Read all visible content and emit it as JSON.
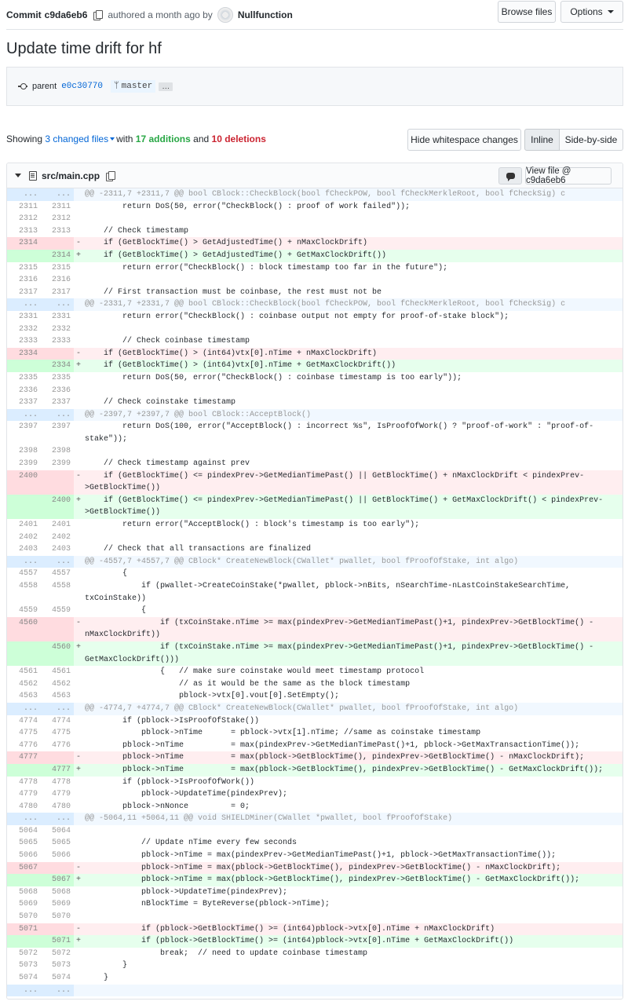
{
  "header": {
    "commit_label": "Commit",
    "sha": "c9da6eb6",
    "authored": "authored a month ago by",
    "author": "Nullfunction",
    "browse_files": "Browse files",
    "options": "Options"
  },
  "title": "Update time drift for hf",
  "meta": {
    "parent_label": "parent",
    "parent_sha": "e0c30770",
    "branch": "master",
    "ellipsis": "…"
  },
  "summary": {
    "showing": "Showing",
    "changed_files": "3 changed files",
    "with": "with",
    "additions": "17 additions",
    "and": "and",
    "deletions": "10 deletions"
  },
  "buttons": {
    "hide_whitespace": "Hide whitespace changes",
    "inline": "Inline",
    "side_by_side": "Side-by-side"
  },
  "file": {
    "name": "src/main.cpp",
    "view_file": "View file @ c9da6eb6"
  },
  "rows": [
    {
      "t": "hunk",
      "a": "...",
      "b": "...",
      "c": "@@ -2311,7 +2311,7 @@ bool CBlock::CheckBlock(bool fCheckPOW, bool fCheckMerkleRoot, bool fCheckSig) c"
    },
    {
      "t": "ctx",
      "a": "2311",
      "b": "2311",
      "c": "        return DoS(50, error(\"CheckBlock() : proof of work failed\"));"
    },
    {
      "t": "ctx",
      "a": "2312",
      "b": "2312",
      "c": ""
    },
    {
      "t": "ctx",
      "a": "2313",
      "b": "2313",
      "c": "    // Check timestamp"
    },
    {
      "t": "del",
      "a": "2314",
      "b": "",
      "s": "-",
      "c": "    if (GetBlockTime() > GetAdjustedTime() + nMaxClockDrift)"
    },
    {
      "t": "add",
      "a": "",
      "b": "2314",
      "s": "+",
      "c": "    if (GetBlockTime() > GetAdjustedTime() + GetMaxClockDrift())"
    },
    {
      "t": "ctx",
      "a": "2315",
      "b": "2315",
      "c": "        return error(\"CheckBlock() : block timestamp too far in the future\");"
    },
    {
      "t": "ctx",
      "a": "2316",
      "b": "2316",
      "c": ""
    },
    {
      "t": "ctx",
      "a": "2317",
      "b": "2317",
      "c": "    // First transaction must be coinbase, the rest must not be"
    },
    {
      "t": "hunk",
      "a": "...",
      "b": "...",
      "c": "@@ -2331,7 +2331,7 @@ bool CBlock::CheckBlock(bool fCheckPOW, bool fCheckMerkleRoot, bool fCheckSig) c"
    },
    {
      "t": "ctx",
      "a": "2331",
      "b": "2331",
      "c": "        return error(\"CheckBlock() : coinbase output not empty for proof-of-stake block\");"
    },
    {
      "t": "ctx",
      "a": "2332",
      "b": "2332",
      "c": ""
    },
    {
      "t": "ctx",
      "a": "2333",
      "b": "2333",
      "c": "        // Check coinbase timestamp"
    },
    {
      "t": "del",
      "a": "2334",
      "b": "",
      "s": "-",
      "c": "    if (GetBlockTime() > (int64)vtx[0].nTime + nMaxClockDrift)"
    },
    {
      "t": "add",
      "a": "",
      "b": "2334",
      "s": "+",
      "c": "    if (GetBlockTime() > (int64)vtx[0].nTime + GetMaxClockDrift())"
    },
    {
      "t": "ctx",
      "a": "2335",
      "b": "2335",
      "c": "        return DoS(50, error(\"CheckBlock() : coinbase timestamp is too early\"));"
    },
    {
      "t": "ctx",
      "a": "2336",
      "b": "2336",
      "c": ""
    },
    {
      "t": "ctx",
      "a": "2337",
      "b": "2337",
      "c": "    // Check coinstake timestamp"
    },
    {
      "t": "hunk",
      "a": "...",
      "b": "...",
      "c": "@@ -2397,7 +2397,7 @@ bool CBlock::AcceptBlock()"
    },
    {
      "t": "ctx",
      "w": 1,
      "a": "2397",
      "b": "2397",
      "c": "        return DoS(100, error(\"AcceptBlock() : incorrect %s\", IsProofOfWork() ? \"proof-of-work\" : \"proof-of-stake\"));"
    },
    {
      "t": "ctx",
      "a": "2398",
      "b": "2398",
      "c": ""
    },
    {
      "t": "ctx",
      "a": "2399",
      "b": "2399",
      "c": "    // Check timestamp against prev"
    },
    {
      "t": "del",
      "w": 1,
      "a": "2400",
      "b": "",
      "s": "-",
      "c": "    if (GetBlockTime() <= pindexPrev->GetMedianTimePast() || GetBlockTime() + nMaxClockDrift < pindexPrev->GetBlockTime())"
    },
    {
      "t": "add",
      "w": 1,
      "a": "",
      "b": "2400",
      "s": "+",
      "c": "    if (GetBlockTime() <= pindexPrev->GetMedianTimePast() || GetBlockTime() + GetMaxClockDrift() < pindexPrev->GetBlockTime())"
    },
    {
      "t": "ctx",
      "a": "2401",
      "b": "2401",
      "c": "        return error(\"AcceptBlock() : block's timestamp is too early\");"
    },
    {
      "t": "ctx",
      "a": "2402",
      "b": "2402",
      "c": ""
    },
    {
      "t": "ctx",
      "a": "2403",
      "b": "2403",
      "c": "    // Check that all transactions are finalized"
    },
    {
      "t": "hunk",
      "a": "...",
      "b": "...",
      "c": "@@ -4557,7 +4557,7 @@ CBlock* CreateNewBlock(CWallet* pwallet, bool fProofOfStake, int algo)"
    },
    {
      "t": "ctx",
      "a": "4557",
      "b": "4557",
      "c": "        {"
    },
    {
      "t": "ctx",
      "w": 1,
      "a": "4558",
      "b": "4558",
      "c": "            if (pwallet->CreateCoinStake(*pwallet, pblock->nBits, nSearchTime-nLastCoinStakeSearchTime, txCoinStake))"
    },
    {
      "t": "ctx",
      "a": "4559",
      "b": "4559",
      "c": "            {"
    },
    {
      "t": "del",
      "w": 1,
      "a": "4560",
      "b": "",
      "s": "-",
      "c": "                if (txCoinStake.nTime >= max(pindexPrev->GetMedianTimePast()+1, pindexPrev->GetBlockTime() - nMaxClockDrift))"
    },
    {
      "t": "add",
      "w": 1,
      "a": "",
      "b": "4560",
      "s": "+",
      "c": "                if (txCoinStake.nTime >= max(pindexPrev->GetMedianTimePast()+1, pindexPrev->GetBlockTime() - GetMaxClockDrift()))"
    },
    {
      "t": "ctx",
      "a": "4561",
      "b": "4561",
      "c": "                {   // make sure coinstake would meet timestamp protocol"
    },
    {
      "t": "ctx",
      "a": "4562",
      "b": "4562",
      "c": "                    // as it would be the same as the block timestamp"
    },
    {
      "t": "ctx",
      "a": "4563",
      "b": "4563",
      "c": "                    pblock->vtx[0].vout[0].SetEmpty();"
    },
    {
      "t": "hunk",
      "a": "...",
      "b": "...",
      "c": "@@ -4774,7 +4774,7 @@ CBlock* CreateNewBlock(CWallet* pwallet, bool fProofOfStake, int algo)"
    },
    {
      "t": "ctx",
      "a": "4774",
      "b": "4774",
      "c": "        if (pblock->IsProofOfStake())"
    },
    {
      "t": "ctx",
      "a": "4775",
      "b": "4775",
      "c": "            pblock->nTime      = pblock->vtx[1].nTime; //same as coinstake timestamp"
    },
    {
      "t": "ctx",
      "a": "4776",
      "b": "4776",
      "c": "        pblock->nTime          = max(pindexPrev->GetMedianTimePast()+1, pblock->GetMaxTransactionTime());"
    },
    {
      "t": "del",
      "a": "4777",
      "b": "",
      "s": "-",
      "c": "        pblock->nTime          = max(pblock->GetBlockTime(), pindexPrev->GetBlockTime() - nMaxClockDrift);"
    },
    {
      "t": "add",
      "a": "",
      "b": "4777",
      "s": "+",
      "c": "        pblock->nTime          = max(pblock->GetBlockTime(), pindexPrev->GetBlockTime() - GetMaxClockDrift());"
    },
    {
      "t": "ctx",
      "a": "4778",
      "b": "4778",
      "c": "        if (pblock->IsProofOfWork())"
    },
    {
      "t": "ctx",
      "a": "4779",
      "b": "4779",
      "c": "            pblock->UpdateTime(pindexPrev);"
    },
    {
      "t": "ctx",
      "a": "4780",
      "b": "4780",
      "c": "        pblock->nNonce         = 0;"
    },
    {
      "t": "hunk",
      "a": "...",
      "b": "...",
      "c": "@@ -5064,11 +5064,11 @@ void SHIELDMiner(CWallet *pwallet, bool fProofOfStake)"
    },
    {
      "t": "ctx",
      "a": "5064",
      "b": "5064",
      "c": ""
    },
    {
      "t": "ctx",
      "a": "5065",
      "b": "5065",
      "c": "            // Update nTime every few seconds"
    },
    {
      "t": "ctx",
      "a": "5066",
      "b": "5066",
      "c": "            pblock->nTime = max(pindexPrev->GetMedianTimePast()+1, pblock->GetMaxTransactionTime());"
    },
    {
      "t": "del",
      "a": "5067",
      "b": "",
      "s": "-",
      "c": "            pblock->nTime = max(pblock->GetBlockTime(), pindexPrev->GetBlockTime() - nMaxClockDrift);"
    },
    {
      "t": "add",
      "a": "",
      "b": "5067",
      "s": "+",
      "c": "            pblock->nTime = max(pblock->GetBlockTime(), pindexPrev->GetBlockTime() - GetMaxClockDrift());"
    },
    {
      "t": "ctx",
      "a": "5068",
      "b": "5068",
      "c": "            pblock->UpdateTime(pindexPrev);"
    },
    {
      "t": "ctx",
      "a": "5069",
      "b": "5069",
      "c": "            nBlockTime = ByteReverse(pblock->nTime);"
    },
    {
      "t": "ctx",
      "a": "5070",
      "b": "5070",
      "c": ""
    },
    {
      "t": "del",
      "a": "5071",
      "b": "",
      "s": "-",
      "c": "            if (pblock->GetBlockTime() >= (int64)pblock->vtx[0].nTime + nMaxClockDrift)"
    },
    {
      "t": "add",
      "a": "",
      "b": "5071",
      "s": "+",
      "c": "            if (pblock->GetBlockTime() >= (int64)pblock->vtx[0].nTime + GetMaxClockDrift())"
    },
    {
      "t": "ctx",
      "a": "5072",
      "b": "5072",
      "c": "                break;  // need to update coinbase timestamp"
    },
    {
      "t": "ctx",
      "a": "5073",
      "b": "5073",
      "c": "        }"
    },
    {
      "t": "ctx",
      "a": "5074",
      "b": "5074",
      "c": "    }"
    },
    {
      "t": "hunk",
      "a": "...",
      "b": "...",
      "c": ""
    }
  ]
}
